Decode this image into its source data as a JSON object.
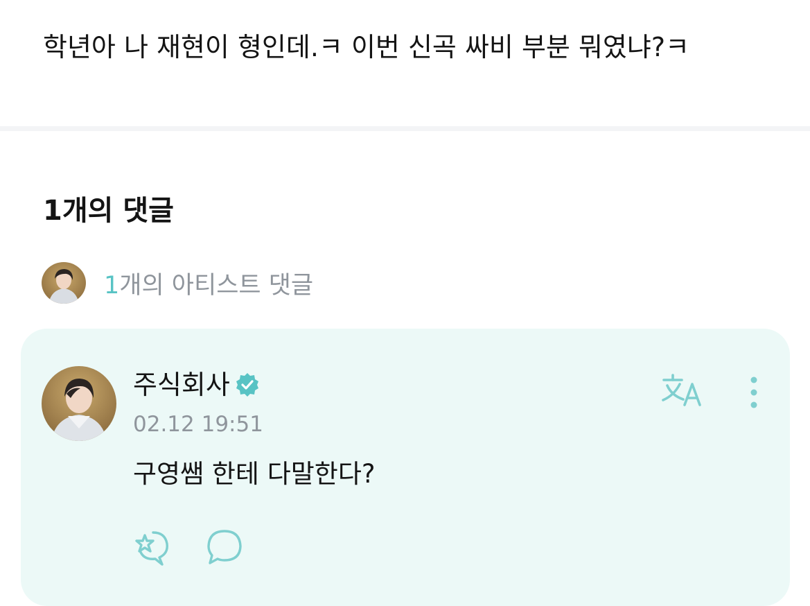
{
  "post": {
    "body_text": "학년아 나 재현이 형인데.ㅋ 이번 신곡 싸비 부분 뭐였냐?ㅋ"
  },
  "comments": {
    "heading": "1개의 댓글",
    "artist_summary": {
      "count": "1",
      "label": "개의 아티스트 댓글"
    },
    "items": [
      {
        "author": "주식회사",
        "verified": true,
        "timestamp": "02.12 19:51",
        "text": "구영쌤 한테 다말한다?"
      }
    ]
  },
  "icons": {
    "verified": "verified-badge-icon",
    "translate": "translate-icon",
    "more": "more-vertical-icon",
    "reaction": "reaction-icon",
    "reply": "comment-bubble-icon"
  },
  "colors": {
    "accent": "#58c3c4",
    "card_background": "#ecf9f7",
    "muted_text": "#8f959c",
    "divider": "#f3f4f6"
  }
}
